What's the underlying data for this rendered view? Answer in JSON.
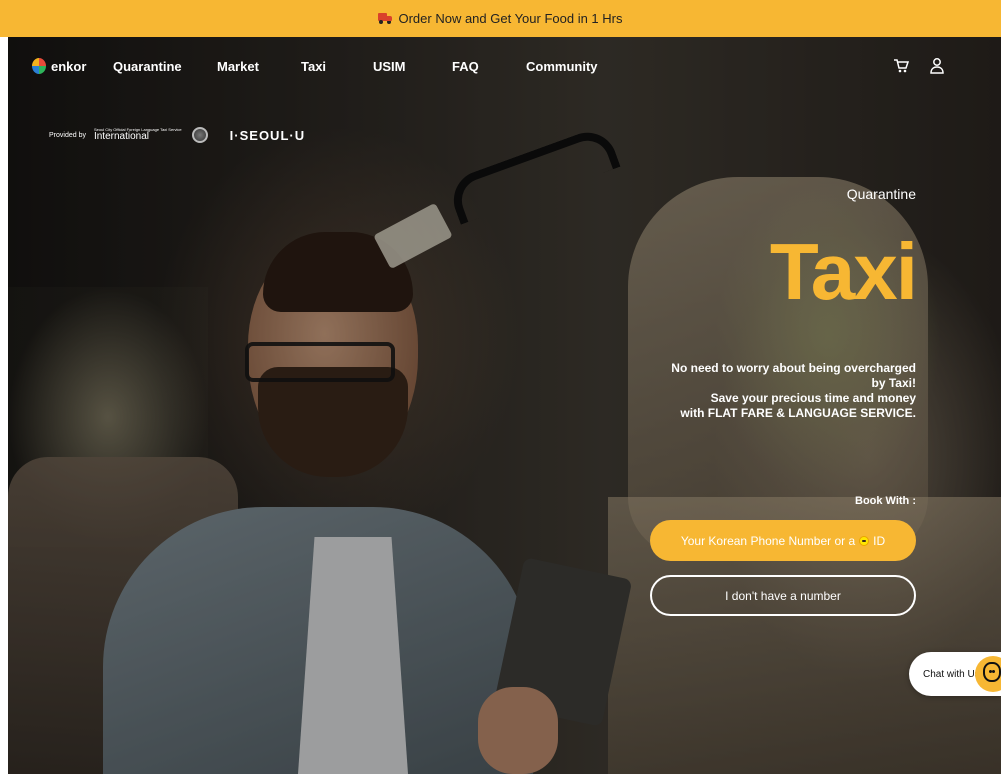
{
  "promo": {
    "text": "Order Now and Get Your Food in 1 Hrs",
    "icon": "delivery-truck-icon"
  },
  "header": {
    "logo_text": "enkor",
    "nav": [
      {
        "label": "Quarantine"
      },
      {
        "label": "Market"
      },
      {
        "label": "Taxi"
      },
      {
        "label": "USIM"
      },
      {
        "label": "FAQ"
      },
      {
        "label": "Community"
      }
    ],
    "icons": [
      "cart-icon",
      "user-icon"
    ]
  },
  "partner": {
    "provided_by": "Provided by",
    "intl_small": "Seoul City Official Foreign Language Taxi Service",
    "intl_big": "International",
    "seoul_logo": "I·SEOUL·U"
  },
  "hero": {
    "eyebrow": "Quarantine",
    "headline": "Taxi",
    "desc_line1": "No need to worry about being overcharged by Taxi!",
    "desc_line2": "Save your precious time and money",
    "desc_line3": "with FLAT FARE & LANGUAGE SERVICE.",
    "book_label": "Book With :",
    "primary_button": "Your Korean Phone Number or a",
    "primary_button_suffix": "ID",
    "secondary_button": "I don't have a number"
  },
  "chat": {
    "label": "Chat with Us"
  },
  "colors": {
    "accent": "#f7b733",
    "text_on_dark": "#ffffff"
  }
}
